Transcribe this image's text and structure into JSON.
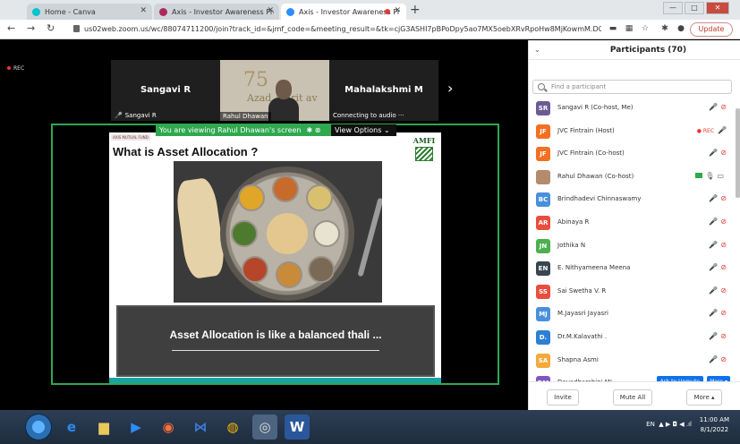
{
  "browser": {
    "tabs": [
      {
        "title": "Home - Canva",
        "icon_color": "#00c4cc",
        "active": false
      },
      {
        "title": "Axis - Investor Awareness Progra",
        "icon_color": "#ae275f",
        "active": false
      },
      {
        "title": "Axis - Investor Awareness Pr",
        "icon_color": "#2d8cff",
        "active": true
      }
    ],
    "url": "us02web.zoom.us/wc/88074711200/join?track_id=&jmf_code=&meeting_result=&tk=cjG3ASHI7pBPoDpy5ao7MX5oebXRvRpoHw8MjKowmM.DQMAAA...",
    "update_label": "Update",
    "win_min": "—",
    "win_max": "□",
    "win_close": "✕"
  },
  "meeting": {
    "rec_label": "REC",
    "thumbs": [
      {
        "name": "Sangavi R",
        "label": "Sangavi R"
      },
      {
        "label": "Rahul Dhawan",
        "logo": "75",
        "logo_sub": "Azad Amrit  av"
      },
      {
        "name": "Mahalakshmi M",
        "label": "Connecting to audio ···"
      }
    ],
    "next_arrow": "›",
    "view_banner": "You are viewing Rahul Dhawan's screen",
    "view_options": "View Options ⌄",
    "slide": {
      "header_logo": "AXIS MUTUAL FUND",
      "title": "What is Asset Allocation ?",
      "amfi": "AMFI",
      "caption": "Asset Allocation is like a balanced thali ..."
    }
  },
  "participants_panel": {
    "title": "Participants (70)",
    "collapse": "⌄",
    "search_placeholder": "Find a participant",
    "participants": [
      {
        "initials": "SR",
        "color": "#6b5b95",
        "name": "Sangavi R (Co-host, Me)",
        "icons": "muted"
      },
      {
        "initials": "JF",
        "color": "#f37021",
        "name": "JVC Fintrain (Host)",
        "icons": "rec"
      },
      {
        "initials": "JF",
        "color": "#f37021",
        "name": "JVC Fintrain (Co-host)",
        "icons": "muted"
      },
      {
        "initials": "",
        "color": "#b58b6d",
        "name": "Rahul Dhawan (Co-host)",
        "icons": "active"
      },
      {
        "initials": "BC",
        "color": "#4a90d9",
        "name": "Brindhadevi Chinnaswamy",
        "icons": "muted"
      },
      {
        "initials": "AR",
        "color": "#e94e3c",
        "name": "Abinaya R",
        "icons": "muted"
      },
      {
        "initials": "JN",
        "color": "#4caf50",
        "name": "Jothika N",
        "icons": "muted"
      },
      {
        "initials": "EN",
        "color": "#37474f",
        "name": "E. Nithyameena Meena",
        "icons": "muted"
      },
      {
        "initials": "SS",
        "color": "#e94e3c",
        "name": "Sai Swetha V. R",
        "icons": "muted"
      },
      {
        "initials": "MJ",
        "color": "#4a90d9",
        "name": "M.Jayasri Jayasri",
        "icons": "muted"
      },
      {
        "initials": "D.",
        "color": "#2d7fd3",
        "name": "Dr.M.Kalavathi .",
        "icons": "muted"
      },
      {
        "initials": "SA",
        "color": "#f4a93b",
        "name": "Shapna Asmi",
        "icons": "muted"
      },
      {
        "initials": "DM",
        "color": "#7e57c2",
        "name": "Devadharshini ML",
        "icons": "ask"
      }
    ],
    "rec_badge": "● REC",
    "ask_label": "Ask to Unmute",
    "more_label": "More ▾",
    "footer": {
      "invite": "Invite",
      "mute_all": "Mute All",
      "more": "More ▴"
    }
  },
  "taskbar": {
    "tray_lang": "EN",
    "tray_icons": "▲  ▶  ◘  ◀  .ıl",
    "time": "11:00 AM",
    "date": "8/1/2022"
  }
}
